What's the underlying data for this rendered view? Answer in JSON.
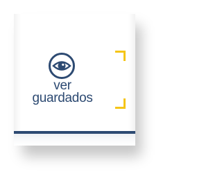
{
  "panel": {
    "action_line1": "ver",
    "action_line2": "guardados",
    "icon": "eye-icon"
  },
  "colors": {
    "primary": "#2d4a72",
    "accent": "#f5c518",
    "background": "#ffffff"
  }
}
